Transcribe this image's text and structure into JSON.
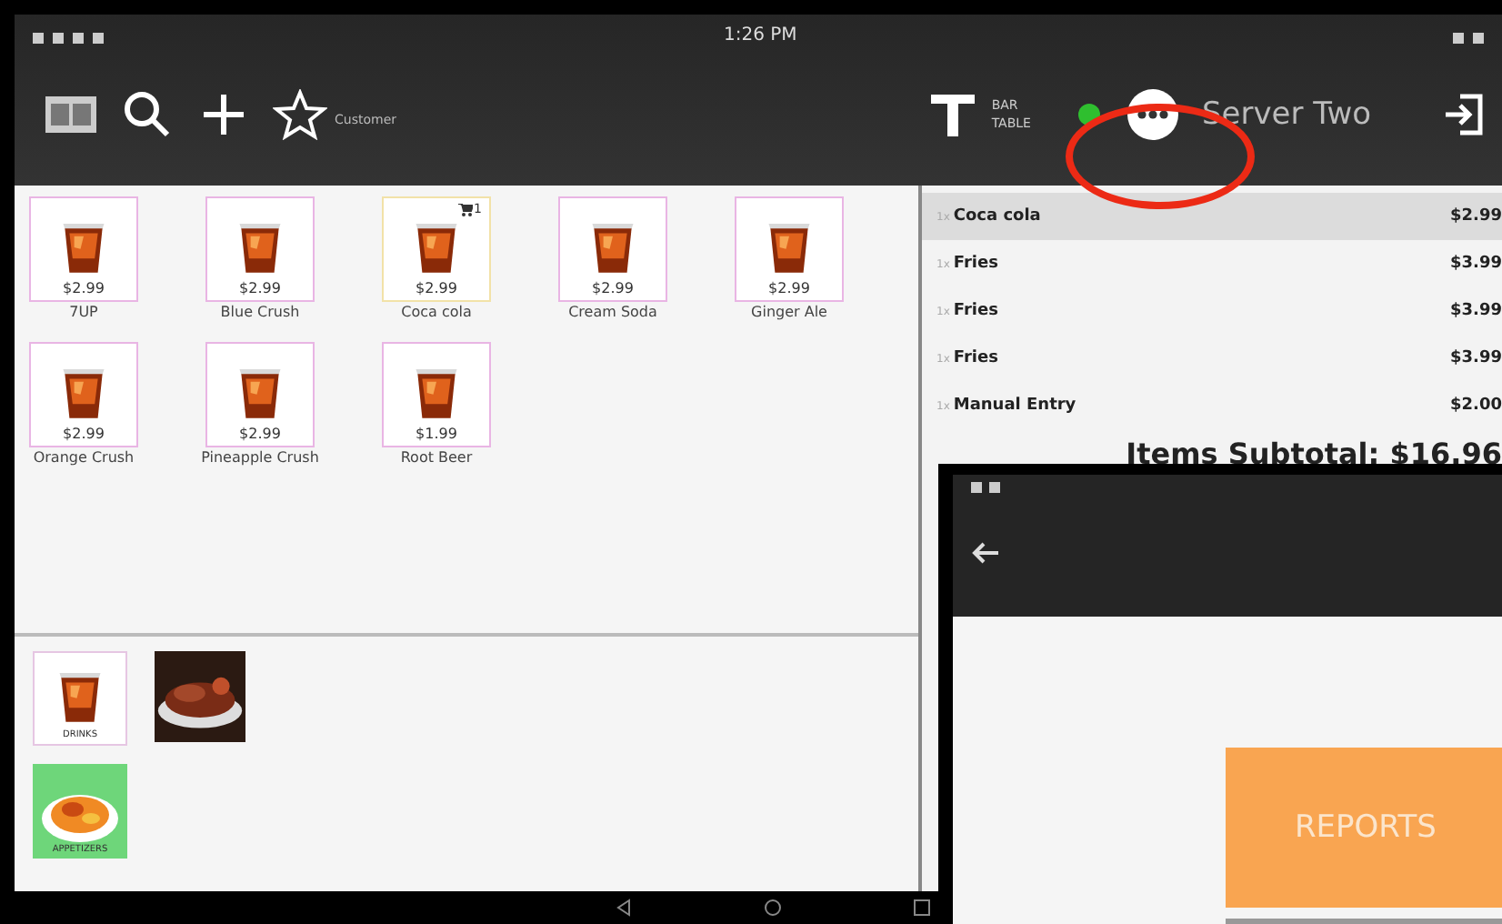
{
  "status_bar": {
    "time": "1:26 PM"
  },
  "toolbar": {
    "customer_label": "Customer",
    "table_labels": [
      "BAR",
      "TABLE"
    ],
    "online": true,
    "user": "Server Two"
  },
  "products": [
    {
      "name": "7UP",
      "price": "$2.99",
      "in_cart": false
    },
    {
      "name": "Blue Crush",
      "price": "$2.99",
      "in_cart": false
    },
    {
      "name": "Coca cola",
      "price": "$2.99",
      "in_cart": true,
      "cart_count": "1"
    },
    {
      "name": "Cream Soda",
      "price": "$2.99",
      "in_cart": false
    },
    {
      "name": "Ginger Ale",
      "price": "$2.99",
      "in_cart": false
    },
    {
      "name": "Orange Crush",
      "price": "$2.99",
      "in_cart": false
    },
    {
      "name": "Pineapple Crush",
      "price": "$2.99",
      "in_cart": false
    },
    {
      "name": "Root Beer",
      "price": "$1.99",
      "in_cart": false
    }
  ],
  "categories": [
    {
      "kind": "drink",
      "label": "DRINKS"
    },
    {
      "kind": "picture"
    },
    {
      "kind": "appetizer",
      "label": "APPETIZERS"
    }
  ],
  "order": {
    "items": [
      {
        "qty": "1x",
        "name": "Coca cola",
        "price": "$2.99",
        "selected": true
      },
      {
        "qty": "1x",
        "name": "Fries",
        "price": "$3.99",
        "selected": false
      },
      {
        "qty": "1x",
        "name": "Fries",
        "price": "$3.99",
        "selected": false
      },
      {
        "qty": "1x",
        "name": "Fries",
        "price": "$3.99",
        "selected": false
      },
      {
        "qty": "1x",
        "name": "Manual Entry",
        "price": "$2.00",
        "selected": false
      }
    ],
    "subtotal": "Items Subtotal: $16.96"
  },
  "overlay": {
    "button": "REPORTS"
  }
}
